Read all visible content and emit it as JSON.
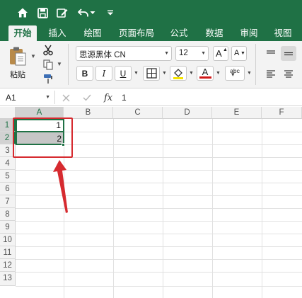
{
  "colors": {
    "brand_green": "#1f7145",
    "ribbon_bg": "#f3f3f3",
    "annotation_red": "#d62a2f",
    "selection_fill": "#c6c6c6"
  },
  "quick_access": {
    "icons": [
      "home-icon",
      "save-icon",
      "edit-icon",
      "undo-icon",
      "customize-icon"
    ]
  },
  "tabs": [
    {
      "label": "开始",
      "active": true
    },
    {
      "label": "插入",
      "active": false
    },
    {
      "label": "绘图",
      "active": false
    },
    {
      "label": "页面布局",
      "active": false
    },
    {
      "label": "公式",
      "active": false
    },
    {
      "label": "数据",
      "active": false
    },
    {
      "label": "审阅",
      "active": false
    },
    {
      "label": "视图",
      "active": false
    }
  ],
  "ribbon": {
    "paste_label": "粘贴",
    "font_name": "思源黑体 CN",
    "font_size": "12",
    "grow_label": "A",
    "shrink_label": "A",
    "bold_label": "B",
    "italic_label": "I",
    "underline_label": "U",
    "font_color_label": "A",
    "phonetic_label": "abc",
    "fill_color": "#f5e400",
    "font_color": "#d01818"
  },
  "formula_bar": {
    "name_box": "A1",
    "fx_label": "fx",
    "value": "1"
  },
  "sheet": {
    "columns": [
      "A",
      "B",
      "C",
      "D",
      "E",
      "F"
    ],
    "rows": [
      "1",
      "2",
      "3",
      "4",
      "5",
      "6",
      "7",
      "8",
      "9",
      "10",
      "11",
      "12",
      "13"
    ],
    "cells": [
      {
        "ref": "A1",
        "value": "1"
      },
      {
        "ref": "A2",
        "value": "2"
      }
    ],
    "selection": "A1:A2",
    "active_cell": "A1"
  }
}
